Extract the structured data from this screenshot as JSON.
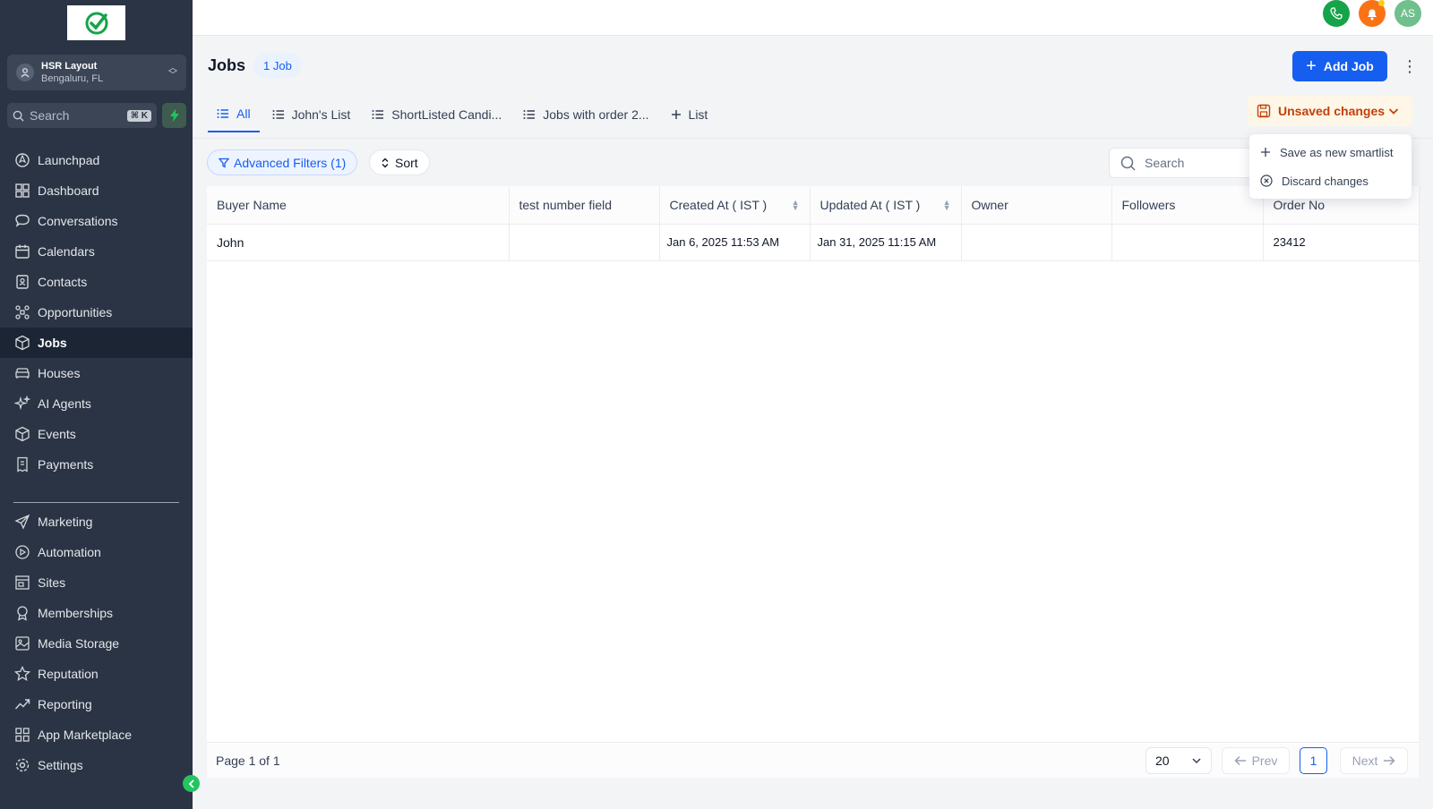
{
  "sidebar": {
    "location": {
      "name": "HSR Layout",
      "subtitle": "Bengaluru, FL"
    },
    "search": {
      "placeholder": "Search",
      "shortcut": "⌘ K"
    },
    "nav_primary": [
      {
        "label": "Launchpad",
        "icon": "launchpad-icon"
      },
      {
        "label": "Dashboard",
        "icon": "dashboard-icon"
      },
      {
        "label": "Conversations",
        "icon": "chat-bubble-icon"
      },
      {
        "label": "Calendars",
        "icon": "calendar-icon"
      },
      {
        "label": "Contacts",
        "icon": "contacts-icon"
      },
      {
        "label": "Opportunities",
        "icon": "opportunities-icon"
      },
      {
        "label": "Jobs",
        "icon": "cube-icon",
        "active": true
      },
      {
        "label": "Houses",
        "icon": "sofa-icon"
      },
      {
        "label": "AI Agents",
        "icon": "sparkles-icon"
      },
      {
        "label": "Events",
        "icon": "cube-icon"
      },
      {
        "label": "Payments",
        "icon": "receipt-icon"
      }
    ],
    "nav_secondary": [
      {
        "label": "Marketing",
        "icon": "send-icon"
      },
      {
        "label": "Automation",
        "icon": "automation-icon"
      },
      {
        "label": "Sites",
        "icon": "sites-icon"
      },
      {
        "label": "Memberships",
        "icon": "award-icon"
      },
      {
        "label": "Media Storage",
        "icon": "image-icon"
      },
      {
        "label": "Reputation",
        "icon": "star-icon"
      },
      {
        "label": "Reporting",
        "icon": "trend-icon"
      },
      {
        "label": "App Marketplace",
        "icon": "grid-icon"
      }
    ],
    "settings_label": "Settings"
  },
  "topbar": {
    "avatar_initials": "AS"
  },
  "header": {
    "title": "Jobs",
    "count_badge": "1 Job",
    "add_button": "Add Job"
  },
  "tabs": [
    {
      "label": "All",
      "active": true
    },
    {
      "label": "John's List"
    },
    {
      "label": "ShortListed Candi..."
    },
    {
      "label": "Jobs with order 2..."
    },
    {
      "label": "List",
      "is_add": true
    }
  ],
  "unsaved": {
    "label": "Unsaved changes",
    "menu": [
      "Save as new smartlist",
      "Discard changes"
    ]
  },
  "filters": {
    "advanced_label": "Advanced Filters (1)",
    "sort_label": "Sort",
    "search_placeholder": "Search"
  },
  "table": {
    "columns": [
      "Buyer Name",
      "test number field",
      "Created At ( IST )",
      "Updated At ( IST )",
      "Owner",
      "Followers",
      "Order No"
    ],
    "rows": [
      [
        "John",
        "",
        "Jan 6, 2025 11:53 AM",
        "Jan 31, 2025 11:15 AM",
        "",
        "",
        "23412"
      ]
    ]
  },
  "pagination": {
    "page_info": "Page 1 of 1",
    "page_size": "20",
    "prev": "Prev",
    "current": "1",
    "next": "Next"
  },
  "colors": {
    "primary": "#155eef",
    "sidebar_bg": "#2a3444",
    "warning": "#c2410c",
    "success": "#22c55e"
  }
}
